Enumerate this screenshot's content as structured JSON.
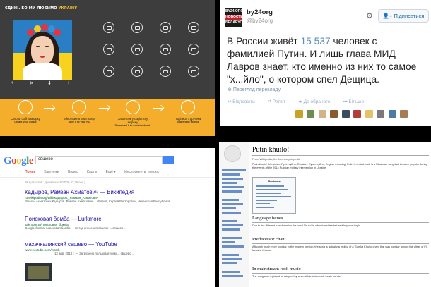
{
  "avatar_app": {
    "title_white": "ЄДИНІ. БО МИ ЛЮБИМО",
    "title_yellow": "УКРАЇНУ",
    "controls": [
      "‹",
      "›",
      "✕",
      "⬇"
    ],
    "steps": [
      {
        "label": "Створи собі аватарку",
        "sub": "Create your avatar"
      },
      {
        "label": "Збережи на комп'ютер",
        "sub": "Save it to your PC"
      },
      {
        "label": "Завантаж у соціальну мережу",
        "sub": "Download it to social network"
      },
      {
        "label": "Поділись з друзями",
        "sub": "Share with friends"
      }
    ],
    "colors": {
      "bg": "#3d3d3d",
      "accent": "#f4ae2b",
      "flag_blue": "#2a7fc4",
      "flag_yellow": "#f7d21f"
    }
  },
  "tweet": {
    "avatar_lines": [
      "BY24.ORG",
      "НОВОСТИ",
      "БЕЛАРУСИ"
    ],
    "name": "by24org",
    "handle": "@by24org",
    "follow_label": "Підписатися",
    "text_pre": "В России живёт ",
    "text_number": "15 537",
    "text_post": " человек с фамилией Путин. И лишь глава МИД Лавров знает, кто именно из них то самое \"х...йло\", о котором спел Дещица.",
    "translate_label": "Перегляд перекладу",
    "actions": [
      "Відповісти",
      "Ретвіт",
      "До обраного",
      "Більше"
    ]
  },
  "google": {
    "query": "свшево",
    "tabs": [
      "Поиск",
      "Картинки",
      "Видео",
      "Карты",
      "Ещё ▾",
      "Инструменты поиска"
    ],
    "active_tab": "Поиск",
    "result_count": "Результатов: примерно 90 000 (0,19 сек.)",
    "results": [
      {
        "title": "Кадыров, Рамзан Ахматович — Википедия",
        "url": "ru.wikipedia.org/wiki/Кадыров,_Рамзан_Ахматович",
        "desc": "Рамзан Ахматович Кадыров. Рамзан Ахматович ... Лавров, Сергей Викторович, Чеченская Республика ..."
      },
      {
        "title": "Поисковая бомба — Lurkmore",
        "url": "lurkmore.to/Поисковая_бомба",
        "desc": "Google-бомба, поисковая бомба — метод внесения ссылок ... свшево ..."
      },
      {
        "title": "махачкалинский свшево — YouTube",
        "url": "www.youtube.com/watch",
        "desc": "13 апр. 2013 г. — Загружено пользователем ... свшево ..."
      }
    ]
  },
  "wiki": {
    "title": "Putin khuilo!",
    "subtitle": "From Wikipedia, the free encyclopedia",
    "intro": "Putin khuilo! (Ukrainian: Путін хуйло, Russian: Путин хуйло, English meaning: Putin is a dickhead) is a Ukrainian song that became popular during the events of the 2014 Russian military intervention in Ukraine.",
    "toc_label": "Contents",
    "sections": [
      "Language issues",
      "Predecessor chant",
      "In mainstream rock music"
    ],
    "section_text": [
      "Due to the different transliteration the word 'khuilo' is often transliterated as Khuylo or huylo.",
      "Although much more popular in the modern version, the song is actually a replica of a 'Sumka Khuilo' chant that was popular among the ultras of FC Metalist Kharkiv.",
      "The song was replayed or adopted by several Ukrainian rock music bands."
    ]
  }
}
